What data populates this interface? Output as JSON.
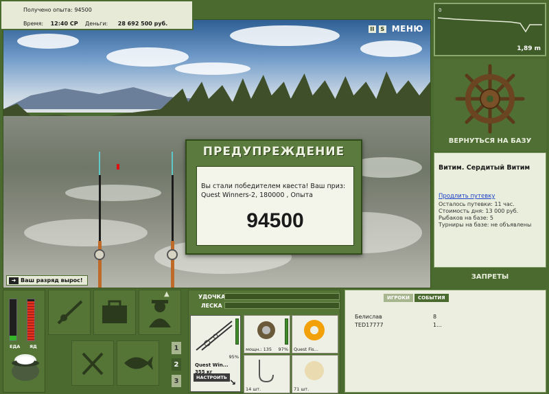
{
  "info": {
    "exp_label": "Получено опыта:",
    "exp_value": "94500",
    "time_label": "Время:",
    "time_value": "12:40 СР",
    "money_label": "Деньги:",
    "money_value": "28 692 500 руб."
  },
  "toolbar": {
    "pause": "II",
    "sound": "S",
    "menu": "МЕНЮ"
  },
  "toast": {
    "text": "Ваш разряд вырос!"
  },
  "dialog": {
    "title": "ПРЕДУПРЕЖДЕНИЕ",
    "message": "Вы стали победителем квеста! Ваш приз: Quest Winners-2, 180000 , Опыта",
    "amount": "94500"
  },
  "depth": {
    "start_label": "0",
    "value": "1,89 m"
  },
  "base": {
    "button": "ВЕРНУТЬСЯ НА БАЗУ",
    "location_name": "Витим. Сердитый Витим",
    "extend_link": "Продлить путевку",
    "lines": [
      "Осталось путевки: 11 час.",
      "Стоимость дня: 13 000 руб.",
      "Рыбаков на базе: 5",
      "Турниры на базе: не объявлены"
    ],
    "bans": "ЗАПРЕТЫ"
  },
  "meters": {
    "food_label": "ЕДА",
    "poison_label": "ЯД",
    "food_level": 0.12,
    "poison_level": 0.95
  },
  "tabs": [
    "1",
    "2",
    "3"
  ],
  "tackle": {
    "rod_label": "УДОЧКА",
    "line_label": "ЛЕСКА",
    "rod_name": "Quest Win...",
    "rod_weight": "355 кг",
    "rod_condition": "95%",
    "set_button": "НАСТРОИТЬ",
    "reel_caption": "мощн.: 135",
    "reel_condition": "97%",
    "line_caption": "Quest Fis...",
    "hook_caption": "14 шт.",
    "bait_caption": "71 шт."
  },
  "players": {
    "tab_players": "ИГРОКИ",
    "tab_events": "СОБЫТИЯ",
    "rows": [
      {
        "name": "Белислав",
        "value": "8"
      },
      {
        "name": "TED17777",
        "value": "1..."
      }
    ]
  },
  "colors": {
    "panel_green": "#4a6a30",
    "light_panel": "#e6ead6",
    "link_blue": "#1a3ec8",
    "rod_grip": "#c06a2a"
  }
}
